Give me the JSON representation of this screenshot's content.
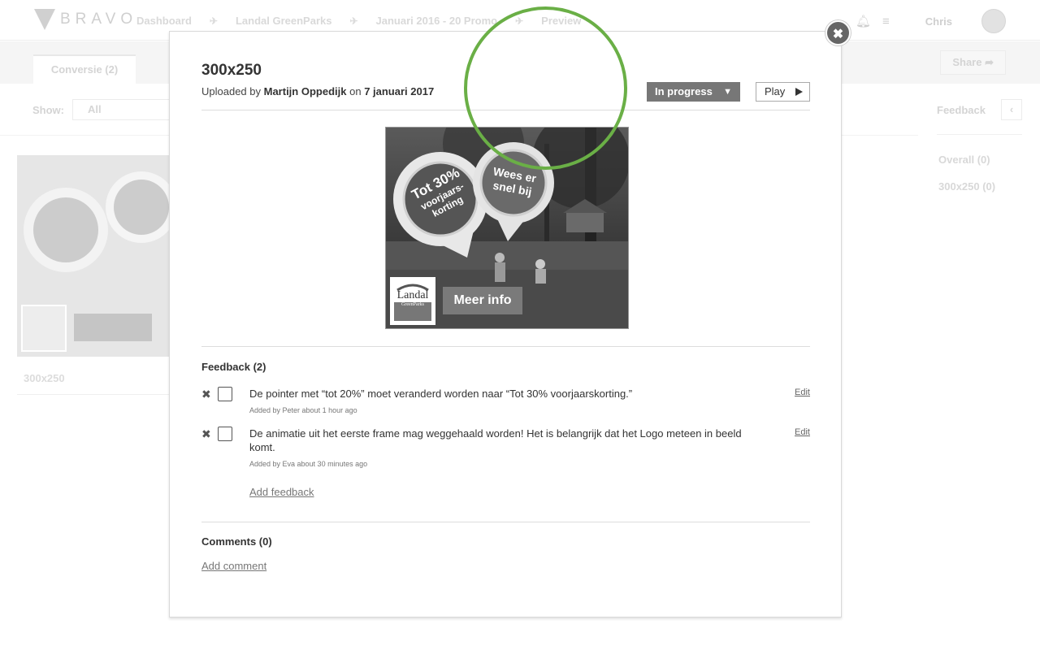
{
  "header": {
    "logo_text": "BRAVO",
    "breadcrumbs": [
      "Dashboard",
      "Landal GreenParks",
      "Januari 2016 - 20 Promo",
      "Preview"
    ],
    "user_name": "Chris"
  },
  "subbar": {
    "tab_label": "Conversie (2)",
    "share_label": "Share"
  },
  "filter": {
    "show_label": "Show:",
    "show_value": "All"
  },
  "sidebar": {
    "feedback_label": "Feedback",
    "items": [
      "Overall (0)",
      "300x250 (0)"
    ]
  },
  "background_card": {
    "label": "300x250"
  },
  "modal": {
    "title": "300x250",
    "uploaded_prefix": "Uploaded by",
    "uploader": "Martijn Oppedijk",
    "on_word": "on",
    "upload_date": "7 januari 2017",
    "status_label": "In progress",
    "play_label": "Play",
    "close_glyph": "✖"
  },
  "banner": {
    "badge_left_lines": [
      "Tot 30%",
      "voorjaars-",
      "korting"
    ],
    "badge_right_lines": [
      "Wees er",
      "snel bij"
    ],
    "brand_name": "Landal",
    "brand_sub": "GreenParks",
    "cta_label": "Meer info"
  },
  "feedback": {
    "title": "Feedback (2)",
    "items": [
      {
        "text": "De pointer met “tot 20%” moet veranderd worden naar “Tot 30% voorjaarskorting.”",
        "added_by": "Added by Peter about 1 hour ago",
        "edit_label": "Edit"
      },
      {
        "text": "De animatie uit het eerste frame mag weggehaald worden! Het is belangrijk dat het Logo meteen in beeld komt.",
        "added_by": "Added by Eva about 30 minutes ago",
        "edit_label": "Edit"
      }
    ],
    "add_label": "Add feedback"
  },
  "comments": {
    "title": "Comments (0)",
    "add_label": "Add comment"
  },
  "colors": {
    "accent_ring": "#6aaf46",
    "status_bg": "#777777"
  }
}
